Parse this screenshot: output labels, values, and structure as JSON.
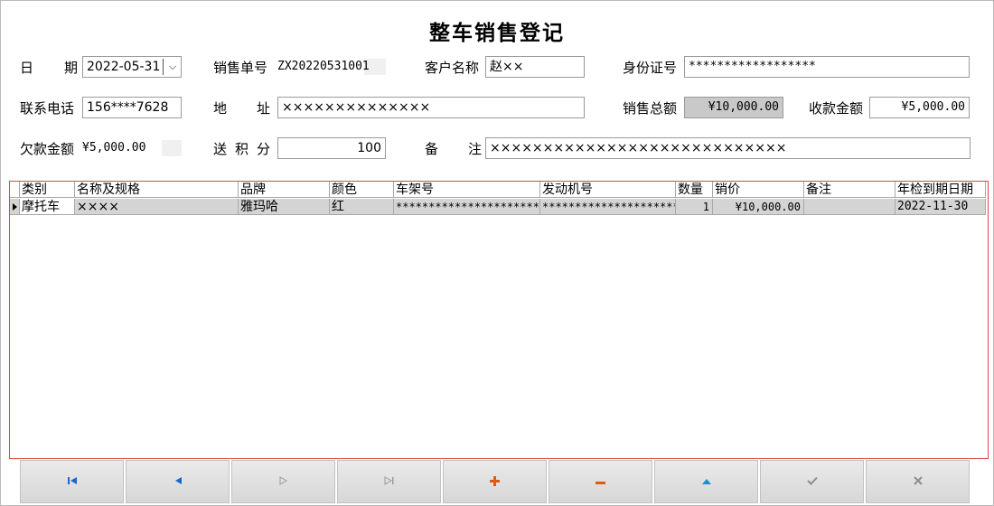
{
  "window": {
    "title": "整车销售登记"
  },
  "form": {
    "date_label": "日期",
    "date_value": "2022-05-31",
    "order_label": "销售单号",
    "order_value": "ZX20220531001",
    "customer_label": "客户名称",
    "customer_value": "赵××",
    "id_label": "身份证号",
    "id_value": "******************",
    "phone_label": "联系电话",
    "phone_value": "156****7628",
    "address_label": "地址",
    "address_value": "××××××××××××××",
    "total_label": "销售总额",
    "total_value": "¥10,000.00",
    "received_label": "收款金额",
    "received_value": "¥5,000.00",
    "owed_label": "欠款金额",
    "owed_value": "¥5,000.00",
    "points_label": "送积分",
    "points_value": "100",
    "note_label": "备注",
    "note_value": "××××××××××××××××××××××××××××"
  },
  "grid": {
    "columns": [
      "类别",
      "名称及规格",
      "品牌",
      "颜色",
      "车架号",
      "发动机号",
      "数量",
      "销价",
      "备注",
      "年检到期日期"
    ],
    "rows": [
      {
        "category": "摩托车",
        "name": "××××",
        "brand": "雅玛哈",
        "color": "红",
        "frame_no": "***********************",
        "engine_no": "************************",
        "qty": "1",
        "price": "¥10,000.00",
        "note": "",
        "inspection": "2022-11-30"
      }
    ]
  },
  "toolbar": {
    "first": "first-record-icon",
    "prev": "prev-record-icon",
    "next": "next-record-icon",
    "last": "last-record-icon",
    "add": "add-icon",
    "delete": "delete-icon",
    "edit": "edit-icon",
    "save": "save-icon",
    "cancel": "cancel-icon",
    "colors": {
      "nav": "#1a66cc",
      "add_delete": "#e05a14",
      "disabled": "#9a9a9a"
    }
  }
}
